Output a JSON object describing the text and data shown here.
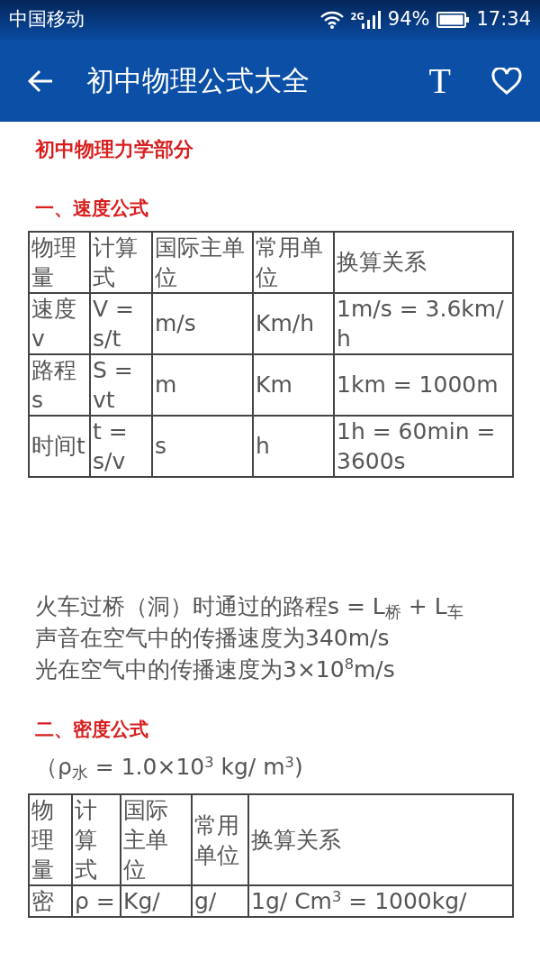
{
  "status_bar": {
    "carrier": "中国移动",
    "network": "2G",
    "battery": "94%",
    "time": "17:34"
  },
  "app_bar": {
    "title": "初中物理公式大全",
    "font_button": "T"
  },
  "content": [
    {
      "kind": "title",
      "text": "初中物理力学部分"
    },
    {
      "kind": "heading",
      "text": "一、速度公式"
    },
    {
      "kind": "table",
      "columns": [
        "物理量",
        "计算式",
        "国际主单位",
        "常用单位",
        "换算关系"
      ],
      "rows": [
        [
          "速度v",
          "V = s/t",
          "m/s",
          "Km/h",
          "1m/s = 3.6km/h"
        ],
        [
          "路程s",
          "S = vt",
          "m",
          "Km",
          "1km = 1000m"
        ],
        [
          "时间t",
          "t = s/v",
          "s",
          "h",
          "1h = 60min = 3600s"
        ]
      ]
    },
    {
      "kind": "paragraph",
      "text": "火车过桥（洞）时通过的路程s = L$_{桥}$ + L$_{车}$"
    },
    {
      "kind": "paragraph",
      "text": "声音在空气中的传播速度为340m/s"
    },
    {
      "kind": "paragraph",
      "text": "光在空气中的传播速度为3×10$^{8}$m/s"
    },
    {
      "kind": "heading",
      "text": "二、密度公式"
    },
    {
      "kind": "paragraph",
      "text": "（ρ$_{水}$ = 1.0×10$^{3}$ kg/ m$^{3}$)"
    },
    {
      "kind": "table",
      "columns": [
        "物理量",
        "计算式",
        "国际主单位",
        "常用单位",
        "换算关系"
      ],
      "rows": [
        [
          "密",
          "ρ =",
          "Kg/",
          "g/",
          "1g/ Cm$^{3}$ = 1000kg/"
        ]
      ]
    }
  ]
}
